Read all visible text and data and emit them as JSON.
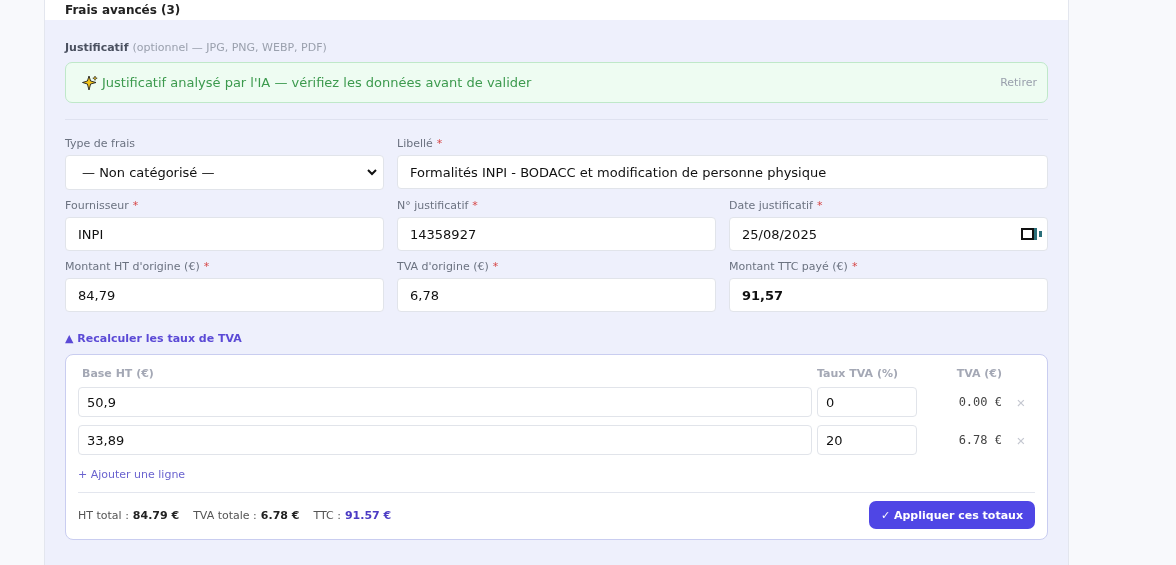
{
  "section_title": "Frais avancés (3)",
  "receipt": {
    "label": "Justificatif",
    "hint": "(optionnel — JPG, PNG, WEBP, PDF)",
    "banner": {
      "text": "Justificatif analysé par l'IA — vérifiez les données avant de valider",
      "action": "Retirer"
    }
  },
  "fields": [
    {
      "kind": "select",
      "label": "Type de frais",
      "value": "— Non catégorisé —"
    },
    {
      "kind": "text",
      "label": "Libellé",
      "required_mark": "*",
      "value": "Formalités INPI - BODACC et modification de personne physique",
      "wide": true
    },
    {
      "kind": "text",
      "label": "Fournisseur",
      "required_mark": "*",
      "value": "INPI"
    },
    {
      "kind": "text",
      "label": "N° justificatif",
      "required_mark": "*",
      "value": "14358927"
    },
    {
      "kind": "date",
      "label": "Date justificatif",
      "required_mark": "*",
      "value": "25/08/2025"
    },
    {
      "kind": "text",
      "label": "Montant HT d'origine (€)",
      "required_mark": "*",
      "value": "84,79"
    },
    {
      "kind": "text",
      "label": "TVA d'origine (€)",
      "required_mark": "*",
      "value": "6,78"
    },
    {
      "kind": "text",
      "label": "Montant TTC payé (€)",
      "required_mark": "*",
      "value": "91,57",
      "emphasis": true
    }
  ],
  "vat_recalc": {
    "toggle": "▲ Recalculer les taux de TVA",
    "expanded": true,
    "columns": [
      "Base HT (€)",
      "Taux TVA (%)",
      "TVA (€)"
    ],
    "rows": [
      {
        "base": "50,9",
        "rate": "0",
        "amount": "0.00 €",
        "remove": "×"
      },
      {
        "base": "33,89",
        "rate": "20",
        "amount": "6.78 €",
        "remove": "×"
      }
    ],
    "add_line": "+ Ajouter une ligne",
    "totals": [
      {
        "label": "HT total :",
        "value": "84.79 €",
        "highlight": false
      },
      {
        "label": "TVA totale :",
        "value": "6.78 €",
        "highlight": false
      },
      {
        "label": "TTC :",
        "value": "91.57 €",
        "highlight": true
      }
    ],
    "apply_button": "✓ Appliquer ces totaux"
  }
}
